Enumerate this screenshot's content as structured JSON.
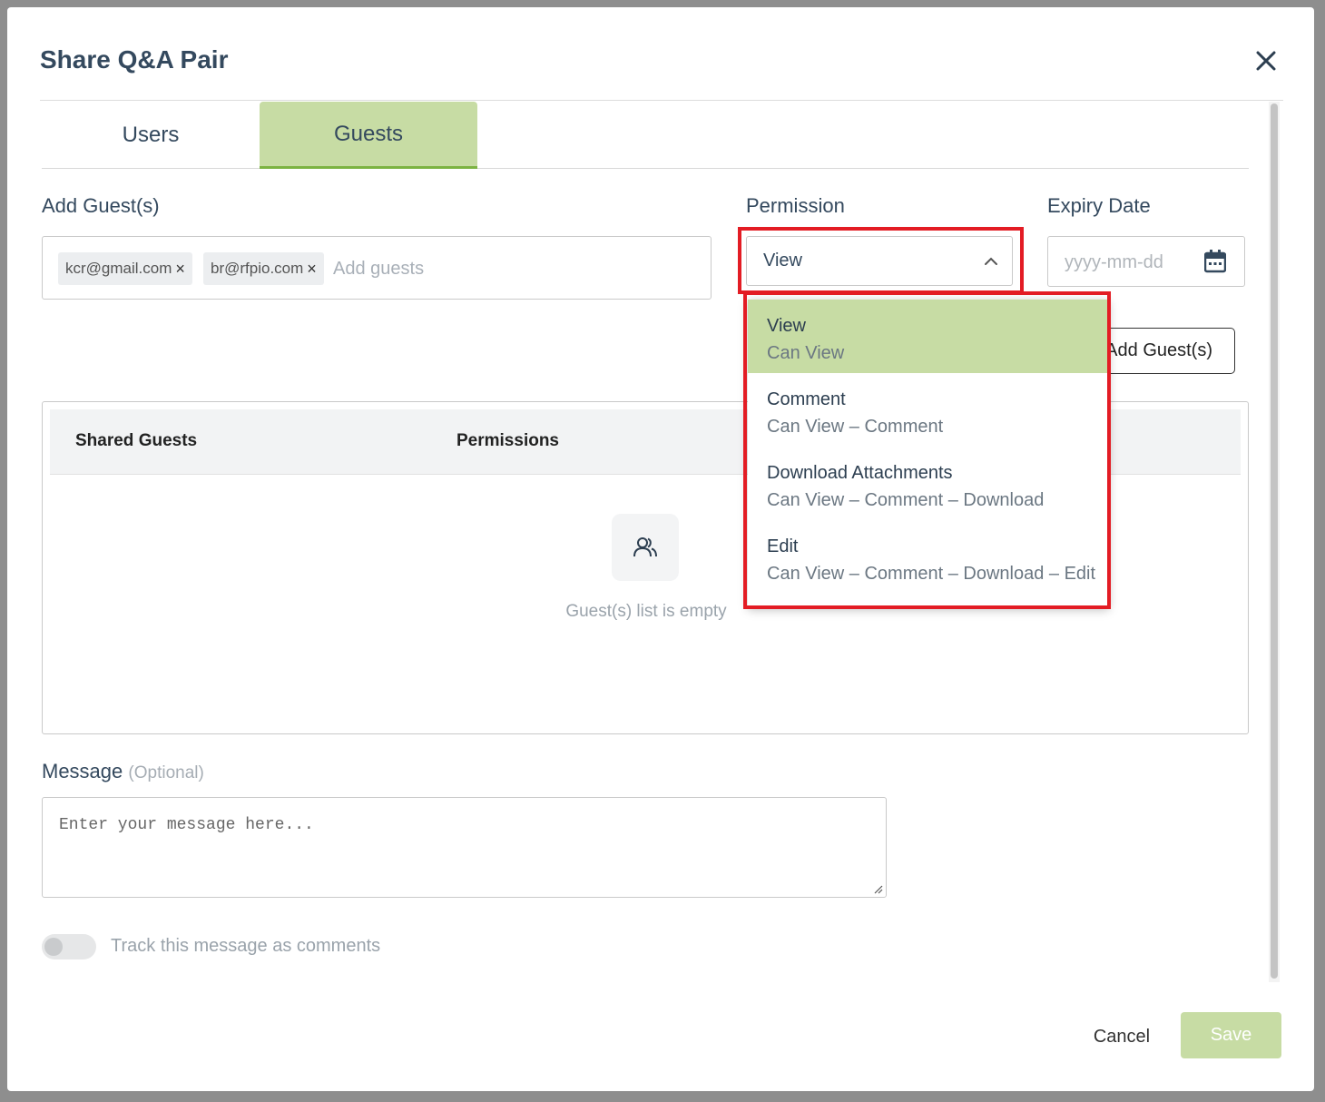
{
  "modal": {
    "title": "Share Q&A Pair"
  },
  "tabs": [
    {
      "label": "Users",
      "active": false
    },
    {
      "label": "Guests",
      "active": true
    }
  ],
  "add_guests": {
    "label": "Add Guest(s)",
    "chips": [
      "kcr@gmail.com",
      "br@rfpio.com"
    ],
    "chip_remove_glyph": "×",
    "placeholder": "Add guests"
  },
  "permission": {
    "label": "Permission",
    "selected": "View",
    "options": [
      {
        "title": "View",
        "desc": "Can View",
        "selected": true
      },
      {
        "title": "Comment",
        "desc": "Can View – Comment",
        "selected": false
      },
      {
        "title": "Download Attachments",
        "desc": "Can View – Comment – Download",
        "selected": false
      },
      {
        "title": "Edit",
        "desc": "Can View – Comment – Download – Edit",
        "selected": false
      }
    ]
  },
  "expiry": {
    "label": "Expiry Date",
    "placeholder": "yyyy-mm-dd"
  },
  "add_guest_button": "Add Guest(s)",
  "shared": {
    "col_guests": "Shared Guests",
    "col_permissions": "Permissions",
    "empty_text": "Guest(s) list is empty"
  },
  "message": {
    "label": "Message",
    "optional": "(Optional)",
    "placeholder": "Enter your message here..."
  },
  "track": {
    "label": "Track this message as comments",
    "on": false
  },
  "footer": {
    "cancel": "Cancel",
    "save": "Save"
  },
  "colors": {
    "accent": "#c7dca4",
    "accent_border": "#7cb342",
    "highlight": "#e31c24"
  },
  "icons": {
    "close": "close-icon",
    "chevron": "chevron-up-icon",
    "calendar": "calendar-icon",
    "users": "users-icon"
  }
}
